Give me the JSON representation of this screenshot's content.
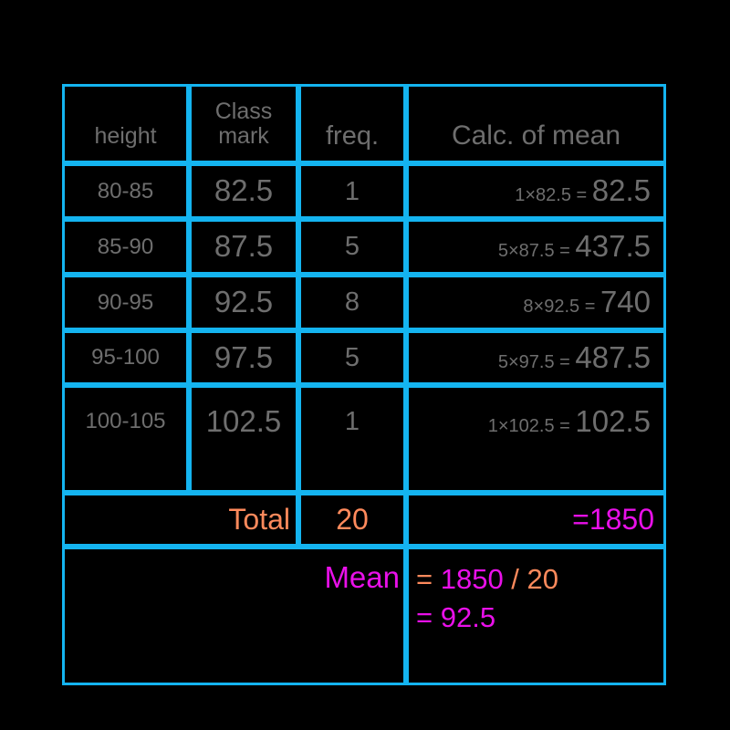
{
  "colors": {
    "background": "#000000",
    "grid": "#14b4f0",
    "text": "#6e6e6e",
    "accent_orange": "#ff8a5c",
    "accent_magenta": "#e910e9"
  },
  "table": {
    "headers": {
      "height": "height",
      "class_mark_line1": "Class",
      "class_mark_line2": "mark",
      "freq": "freq.",
      "calc": "Calc. of mean"
    },
    "rows": [
      {
        "height": "80-85",
        "class_mark": "82.5",
        "freq": "1",
        "calc_expr": "1×82.5 = ",
        "calc_result": "82.5"
      },
      {
        "height": "85-90",
        "class_mark": "87.5",
        "freq": "5",
        "calc_expr": "5×87.5 = ",
        "calc_result": "437.5"
      },
      {
        "height": "90-95",
        "class_mark": "92.5",
        "freq": "8",
        "calc_expr": "8×92.5 = ",
        "calc_result": "740"
      },
      {
        "height": "95-100",
        "class_mark": "97.5",
        "freq": "5",
        "calc_expr": "5×97.5 = ",
        "calc_result": "487.5"
      },
      {
        "height": "100-105",
        "class_mark": "102.5",
        "freq": "1",
        "calc_expr": "1×102.5 = ",
        "calc_result": "102.5"
      }
    ],
    "total_row": {
      "label": "Total",
      "freq": "20",
      "sum": "=1850"
    },
    "mean_row": {
      "label": "Mean",
      "line1_op": "= ",
      "line1_numerator": "1850",
      "line1_divider": " / ",
      "line1_denominator": "20",
      "line2_op": "= ",
      "line2_value": "92.5"
    }
  },
  "chart_data": {
    "type": "table",
    "title": "Calc. of mean",
    "columns": [
      "height",
      "Class mark",
      "freq.",
      "Calc. of mean"
    ],
    "categories": [
      "80-85",
      "85-90",
      "90-95",
      "95-100",
      "100-105"
    ],
    "class_marks": [
      82.5,
      87.5,
      92.5,
      97.5,
      102.5
    ],
    "frequencies": [
      1,
      5,
      8,
      5,
      1
    ],
    "products": [
      82.5,
      437.5,
      740,
      487.5,
      102.5
    ],
    "total_frequency": 20,
    "total_product": 1850,
    "mean": 92.5,
    "mean_expression": "1850 / 20 = 92.5"
  }
}
